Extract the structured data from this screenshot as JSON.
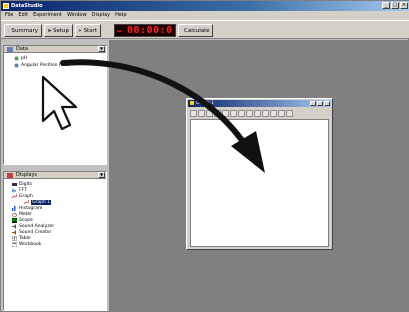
{
  "window": {
    "title": "DataStudio",
    "controls": [
      "_",
      "□",
      "×"
    ]
  },
  "menu": [
    "File",
    "Edit",
    "Experiment",
    "Window",
    "Display",
    "Help"
  ],
  "toolbar": {
    "summary_label": "Summary",
    "setup_label": "Setup",
    "start_label": "Start",
    "clock_value": "00:00:0",
    "calculate_label": "Calculate"
  },
  "data_pane": {
    "title": "Data",
    "items": [
      {
        "label": "pH"
      },
      {
        "label": "Angular Position (rad)"
      }
    ]
  },
  "displays_pane": {
    "title": "Displays",
    "items": [
      {
        "label": "Digits"
      },
      {
        "label": "FFT"
      },
      {
        "label": "Graph"
      },
      {
        "label": "Graph 1"
      },
      {
        "label": "Histogram"
      },
      {
        "label": "Meter"
      },
      {
        "label": "Scope"
      },
      {
        "label": "Sound Analyzer"
      },
      {
        "label": "Sound Creator"
      },
      {
        "label": "Table"
      },
      {
        "label": "Workbook"
      }
    ]
  },
  "graph_window": {
    "title": "Graph 1"
  },
  "colors": {
    "titlebar": "#0a246a",
    "face": "#d4d0c8",
    "workspace": "#808080",
    "led": "#ff2020"
  }
}
